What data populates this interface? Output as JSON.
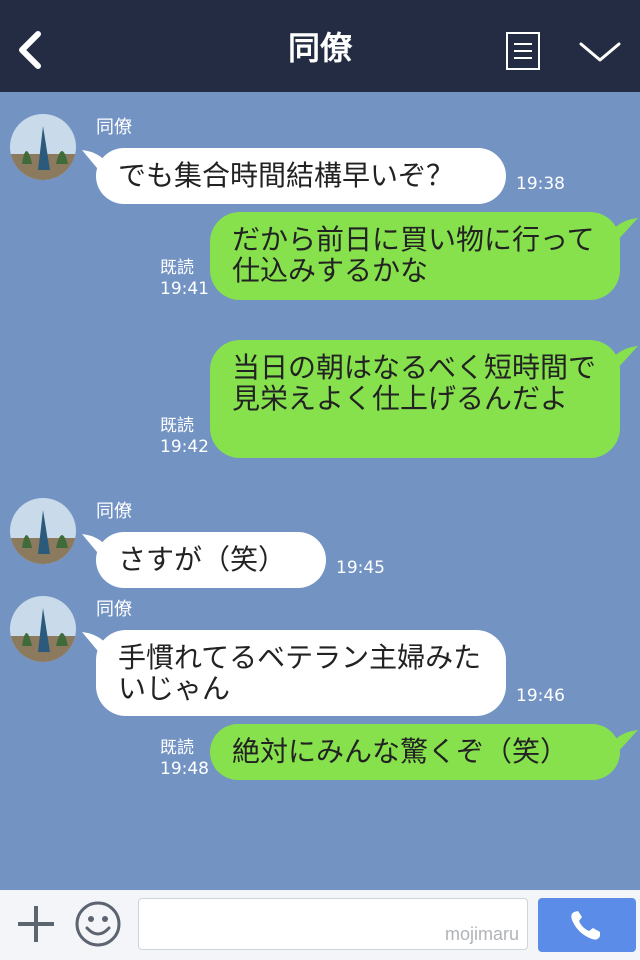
{
  "header": {
    "title": "同僚"
  },
  "messages": [
    {
      "type": "in",
      "sender": "同僚",
      "text": "でも集合時間結構早いぞ？",
      "time": "19:38"
    },
    {
      "type": "out",
      "read": "既読",
      "text": "だから前日に買い物に行って仕込みするかな",
      "time": "19:41"
    },
    {
      "type": "out",
      "read": "既読",
      "text": "当日の朝はなるべく短時間で見栄えよく仕上げるんだよ",
      "time": "19:42"
    },
    {
      "type": "in",
      "sender": "同僚",
      "text": "さすが（笑）",
      "time": "19:45"
    },
    {
      "type": "in",
      "sender": "同僚",
      "text": "手慣れてるベテラン主婦みたいじゃん",
      "time": "19:46"
    },
    {
      "type": "out",
      "read": "既読",
      "text": "絶対にみんな驚くぞ（笑）",
      "time": "19:48"
    }
  ],
  "footer": {
    "watermark": "mojimaru"
  },
  "colors": {
    "header_bg": "#232c42",
    "chat_bg": "#7393c3",
    "outgoing_bubble": "#86e14d",
    "incoming_bubble": "#ffffff",
    "send_button": "#5b8ce8"
  }
}
